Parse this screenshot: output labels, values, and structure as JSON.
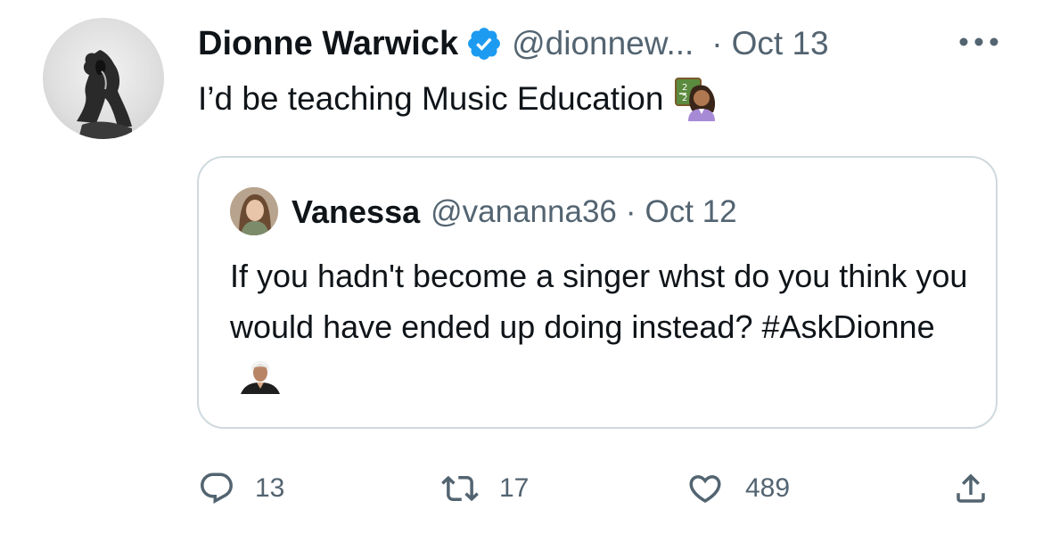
{
  "tweet": {
    "author_name": "Dionne Warwick",
    "author_handle": "@dionnew...",
    "separator": "·",
    "date": "Oct 13",
    "text": "I’d be teaching Music Education",
    "icons": {
      "verified": "verified-badge-icon",
      "more": "more-options-icon",
      "avatar": "avatar"
    }
  },
  "quoted_tweet": {
    "author_name": "Vanessa",
    "author_handle": "@vananna36",
    "separator": "·",
    "date": "Oct 12",
    "text": "If you hadn't become a singer whst do you think you would have ended up doing instead? #AskDionne"
  },
  "actions": {
    "reply": {
      "icon": "reply-icon",
      "count": "13"
    },
    "retweet": {
      "icon": "retweet-icon",
      "count": "17"
    },
    "like": {
      "icon": "heart-icon",
      "count": "489"
    },
    "share": {
      "icon": "share-icon"
    }
  },
  "colors": {
    "text_primary": "#0f1419",
    "text_secondary": "#536471",
    "verified_blue": "#1d9bf0",
    "border": "#cfd9de"
  }
}
